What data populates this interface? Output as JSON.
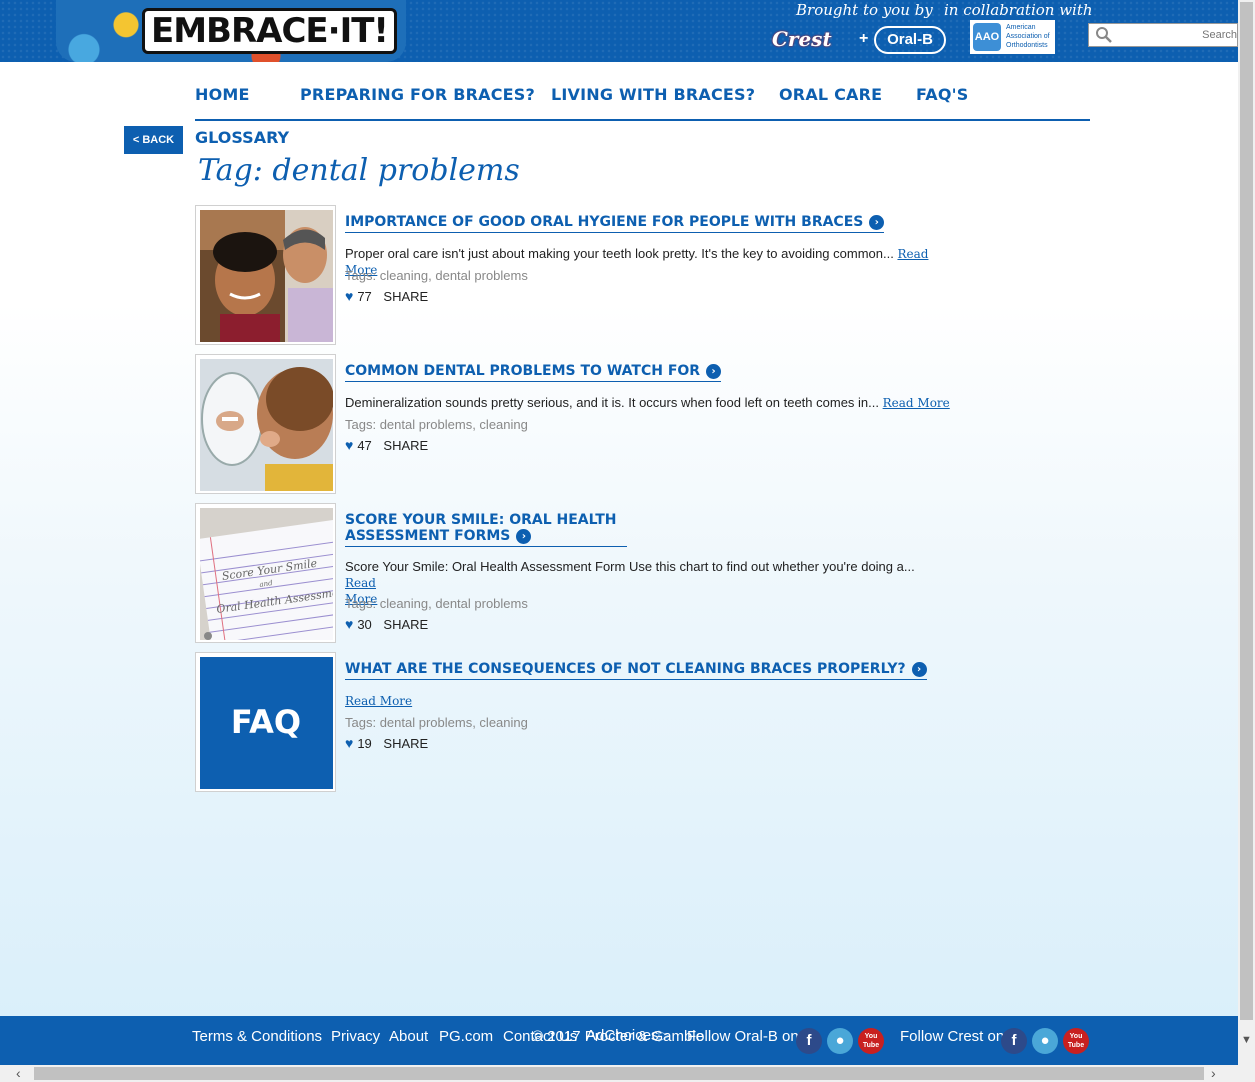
{
  "header": {
    "logo_text": "EMBRACE·IT!",
    "brought_by": "Brought to you by",
    "collaboration": "in collabration with",
    "crest": "Crest",
    "plus": "+",
    "oralb": "Oral-B",
    "aao_mark": "AAO",
    "aao_text": "American Association of Orthodontists",
    "search_placeholder": "Search"
  },
  "nav": {
    "items": [
      {
        "label": "HOME"
      },
      {
        "label": "PREPARING FOR BRACES?"
      },
      {
        "label": "LIVING WITH BRACES?"
      },
      {
        "label": "ORAL CARE"
      },
      {
        "label": "FAQ'S"
      }
    ]
  },
  "page": {
    "back_label": "< BACK",
    "breadcrumb": "GLOSSARY",
    "title": "Tag: dental problems"
  },
  "articles": [
    {
      "title": "IMPORTANCE OF GOOD ORAL HYGIENE FOR PEOPLE WITH BRACES",
      "excerpt": "Proper oral care isn't just about making your teeth look pretty. It's the key to avoiding common...",
      "read_more": "Read More",
      "tags_label": "Tags:",
      "tags": "cleaning, dental problems",
      "likes": "77",
      "share": "SHARE"
    },
    {
      "title": "COMMON DENTAL PROBLEMS TO WATCH FOR",
      "excerpt": "Demineralization sounds pretty serious, and it is. It occurs when food left on teeth comes in...",
      "read_more": "Read More",
      "tags_label": "Tags:",
      "tags": "dental problems, cleaning",
      "likes": "47",
      "share": "SHARE"
    },
    {
      "title_line1": "SCORE YOUR SMILE: ORAL HEALTH",
      "title_line2": "ASSESSMENT FORMS",
      "excerpt": "Score Your Smile: Oral Health Assessment Form Use this chart to find out whether you're doing a...",
      "read_more_1": "Read",
      "read_more_2": "More",
      "tags_label": "Tags:",
      "tags": "cleaning, dental problems",
      "likes": "30",
      "share": "SHARE",
      "thumb_line1": "Score Your Smile",
      "thumb_line2": "and",
      "thumb_line3": "Oral Health Assessment"
    },
    {
      "title": "WHAT ARE THE CONSEQUENCES OF NOT CLEANING BRACES PROPERLY?",
      "read_more": "Read More",
      "tags_label": "Tags:",
      "tags": "dental problems, cleaning",
      "likes": "19",
      "share": "SHARE",
      "thumb_text": "FAQ"
    }
  ],
  "footer": {
    "terms": "Terms & Conditions",
    "privacy": "Privacy",
    "about": "About",
    "pg": "PG.com",
    "contact": "Contact Us",
    "adchoices": "AdChoices",
    "follow_oralb": "Follow Oral-B on",
    "follow_crest": "Follow Crest on",
    "facebook": "f",
    "youtube": "You Tube",
    "copyright": "© 2017 Procter & Gamble"
  },
  "colors": {
    "brand_blue": "#0d5fb0"
  }
}
